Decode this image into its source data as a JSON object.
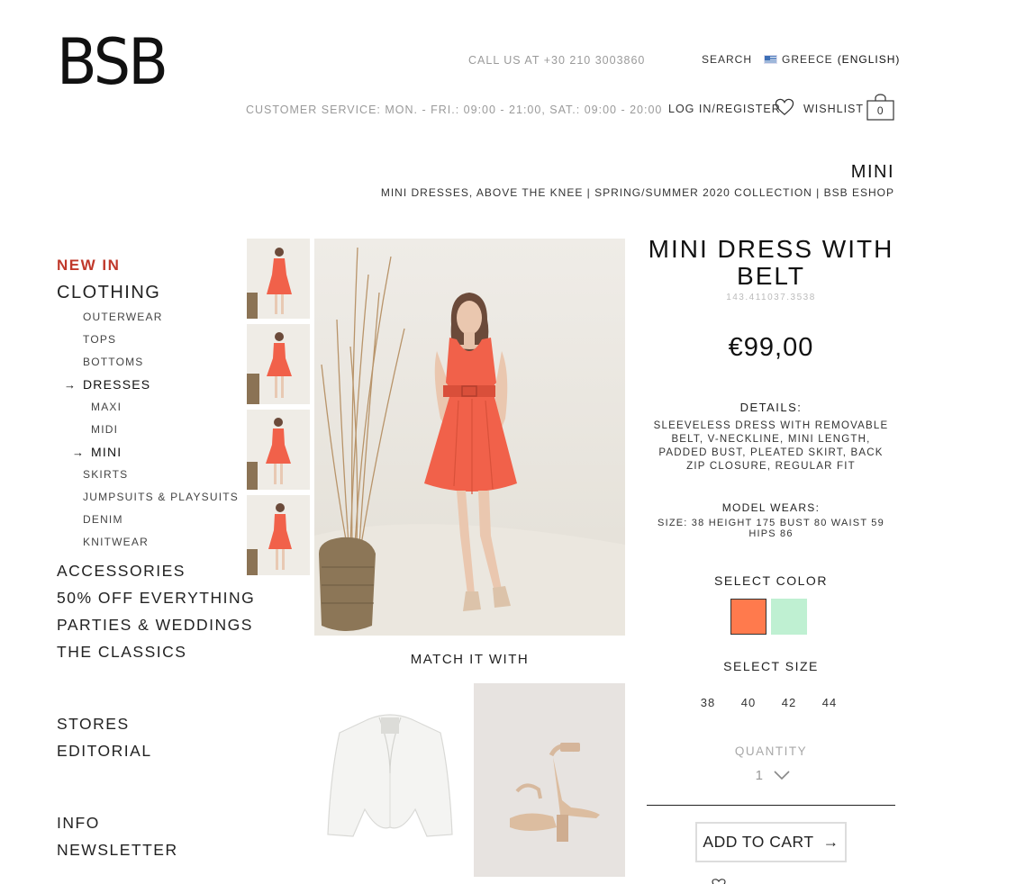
{
  "header": {
    "logo": "BSB",
    "call_us": "CALL US AT +30 210 3003860",
    "customer_service": "CUSTOMER SERVICE: MON. - FRI.: 09:00 - 21:00, SAT.: 09:00 - 20:00",
    "search_label": "SEARCH",
    "country": "GREECE",
    "language": "(ENGLISH)",
    "login_label": "LOG IN/REGISTER",
    "wishlist_label": "WISHLIST",
    "cart_count": "0",
    "flag_icon": "greece-flag-icon",
    "heart_icon": "heart-icon",
    "bag_icon": "shopping-bag-icon"
  },
  "category": {
    "title": "MINI",
    "subtitle": "MINI DRESSES, ABOVE THE KNEE | SPRING/SUMMER 2020 COLLECTION | BSB ESHOP"
  },
  "sidebar": {
    "new_in": "NEW IN",
    "clothing": "CLOTHING",
    "clothing_items": [
      "OUTERWEAR",
      "TOPS",
      "BOTTOMS",
      "DRESSES"
    ],
    "dress_items": [
      "MAXI",
      "MIDI",
      "MINI"
    ],
    "clothing_items_after": [
      "SKIRTS",
      "JUMPSUITS & PLAYSUITS",
      "DENIM",
      "KNITWEAR"
    ],
    "main_items": [
      "ACCESSORIES",
      "50% OFF EVERYTHING",
      "PARTIES & WEDDINGS",
      "THE CLASSICS"
    ],
    "footer_items_a": [
      "STORES",
      "EDITORIAL"
    ],
    "footer_items_b": [
      "INFO",
      "NEWSLETTER"
    ],
    "arrow": "→"
  },
  "gallery": {
    "match_title": "MATCH IT WITH"
  },
  "product": {
    "title": "MINI DRESS WITH BELT",
    "code": "143.411037.3538",
    "price": "€99,00",
    "details_heading": "DETAILS:",
    "details": "SLEEVELESS DRESS WITH REMOVABLE BELT, V-NECKLINE, MINI LENGTH, PADDED BUST, PLEATED SKIRT, BACK ZIP CLOSURE, REGULAR FIT",
    "model_heading": "MODEL WEARS:",
    "model_text": "SIZE: 38 HEIGHT 175 BUST 80 WAIST 59 HIPS 86",
    "color_heading": "SELECT COLOR",
    "colors": [
      "#ff7a4d",
      "#bff0d2"
    ],
    "size_heading": "SELECT SIZE",
    "sizes": [
      "38",
      "40",
      "42",
      "44"
    ],
    "quantity_heading": "QUANTITY",
    "quantity": "1",
    "add_to_cart": "ADD TO CART",
    "cart_arrow": "→"
  },
  "colors": {
    "accent_red": "#c0392b",
    "dress_coral": "#f1614a"
  }
}
